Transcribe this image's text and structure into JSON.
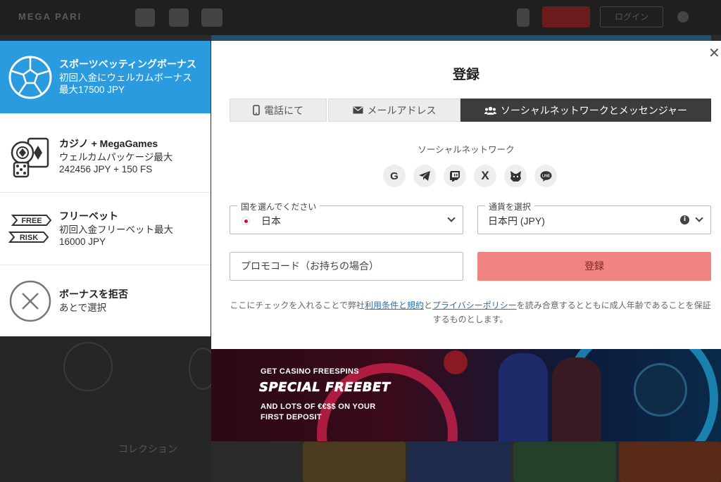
{
  "background": {
    "logo": "MEGA PARI",
    "login_label": "ログイン",
    "collection_label": "コレクション"
  },
  "bonus_panel": {
    "items": [
      {
        "title": "スポーツベッティングボーナス",
        "desc": "初回入金にウェルカムボーナス最大17500 JPY",
        "icon": "soccer-ball-icon",
        "active": true
      },
      {
        "title": "カジノ + MegaGames",
        "desc": "ウェルカムパッケージ最大 242456 JPY + 150 FS",
        "icon": "casino-chips-icon",
        "active": false
      },
      {
        "title": "フリーベット",
        "desc": "初回入金フリーベット最大 16000 JPY",
        "icon": "free-risk-icon",
        "active": false
      },
      {
        "title": "ボーナスを拒否",
        "desc": "あとで選択",
        "icon": "reject-x-icon",
        "active": false
      }
    ],
    "free_risk_icon_text": {
      "top": "FREE",
      "bottom": "RISK"
    }
  },
  "modal": {
    "title": "登録",
    "close_icon": "close-icon",
    "tabs": [
      {
        "label": "電話にて",
        "icon": "phone-icon"
      },
      {
        "label": "メールアドレス",
        "icon": "envelope-icon"
      },
      {
        "label": "ソーシャルネットワークとメッセンジャー",
        "icon": "users-icon",
        "active": true
      }
    ],
    "social_label": "ソーシャルネットワーク",
    "social_buttons": [
      {
        "name": "google",
        "glyph": "G"
      },
      {
        "name": "telegram",
        "glyph": "➤"
      },
      {
        "name": "twitch",
        "glyph": "▣"
      },
      {
        "name": "x",
        "glyph": "X"
      },
      {
        "name": "metamask",
        "glyph": "◆"
      },
      {
        "name": "line",
        "glyph": "LINE"
      }
    ],
    "country": {
      "label": "国を選んでください",
      "value": "日本"
    },
    "currency": {
      "label": "通貨を選択",
      "value": "日本円 (JPY)"
    },
    "promo_placeholder": "プロモコード（お持ちの場合）",
    "submit_label": "登録",
    "terms": {
      "prefix": "ここにチェックを入れることで弊社",
      "link1": "利用条件と規約",
      "mid": "と",
      "link2": "プライバシーポリシー",
      "suffix": "を読み合意するとともに成人年齢であることを保証するものとします。"
    }
  },
  "banner": {
    "line1": "GET CASINO FREESPINS",
    "line2": "SPECIAL FREEBET",
    "line3": "AND LOTS OF €€$$ ON YOUR",
    "line4": "FIRST DEPOSIT"
  }
}
